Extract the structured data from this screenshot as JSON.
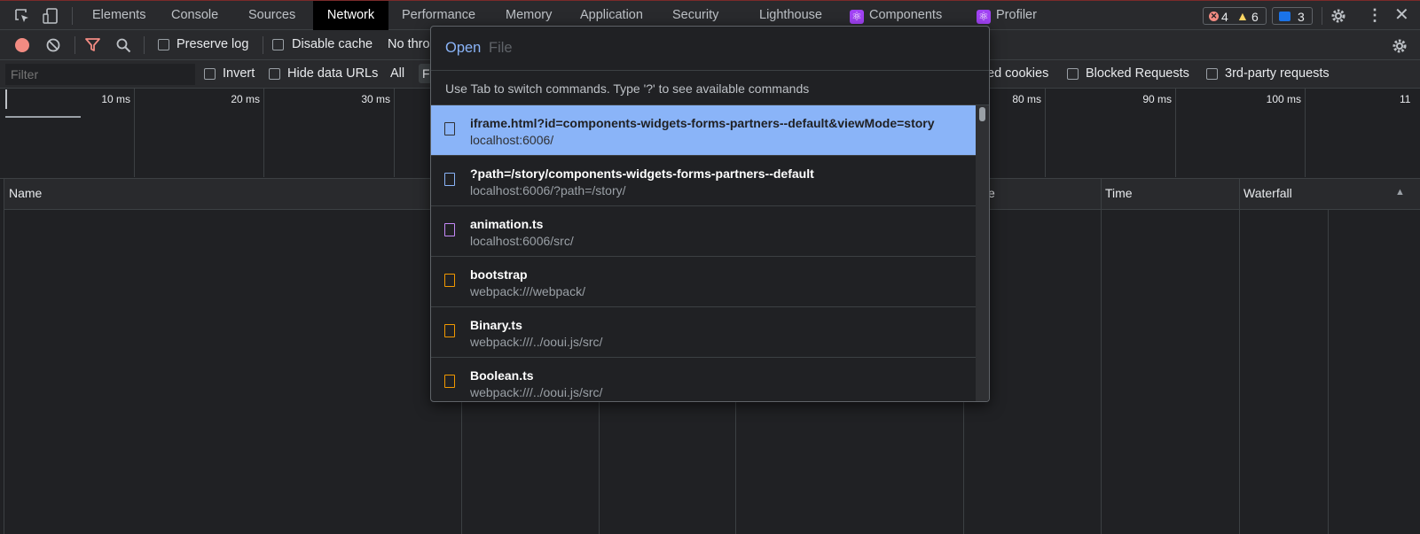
{
  "tabs": [
    "Elements",
    "Console",
    "Sources",
    "Network",
    "Performance",
    "Memory",
    "Application",
    "Security",
    "Lighthouse",
    "Components",
    "Profiler"
  ],
  "counts": {
    "errors": "4",
    "warnings": "6",
    "messages": "3"
  },
  "toolbar": {
    "preserve_log": "Preserve log",
    "disable_cache": "Disable cache",
    "throttle": "No thro"
  },
  "filter": {
    "placeholder": "Filter",
    "invert": "Invert",
    "hide_data_urls": "Hide data URLs",
    "all": "All",
    "f": "F",
    "blocked_cookies": "ed cookies",
    "blocked_requests": "Blocked Requests",
    "third_party": "3rd-party requests"
  },
  "timeline": {
    "ticks": [
      "10 ms",
      "20 ms",
      "30 ms",
      "80 ms",
      "90 ms",
      "100 ms",
      "11"
    ]
  },
  "columns": {
    "name": "Name",
    "size_frag": "e",
    "time": "Time",
    "waterfall": "Waterfall"
  },
  "dialog": {
    "prefix": "Open",
    "placeholder": "File",
    "hint": "Use Tab to switch commands. Type '?' to see available commands",
    "items": [
      {
        "title": "iframe.html?id=components-widgets-forms-partners--default&viewMode=story",
        "subtitle": "localhost:6006/",
        "icon": "document-icon"
      },
      {
        "title": "?path=/story/components-widgets-forms-partners--default",
        "subtitle": "localhost:6006/?path=/story/",
        "icon": "document-icon"
      },
      {
        "title": "animation.ts",
        "subtitle": "localhost:6006/src/",
        "icon": "typescript-file-icon"
      },
      {
        "title": "bootstrap",
        "subtitle": "webpack:///webpack/",
        "icon": "script-file-icon"
      },
      {
        "title": "Binary.ts",
        "subtitle": "webpack:///../ooui.js/src/",
        "icon": "script-file-icon"
      },
      {
        "title": "Boolean.ts",
        "subtitle": "webpack:///../ooui.js/src/",
        "icon": "script-file-icon"
      }
    ]
  },
  "colors": {
    "accent": "#8ab4f8",
    "record": "#f28b82",
    "error": "#f28b82",
    "warning": "#fdd663",
    "doc": "#8ab4f8",
    "ts": "#c58af9",
    "script": "#f29900"
  }
}
